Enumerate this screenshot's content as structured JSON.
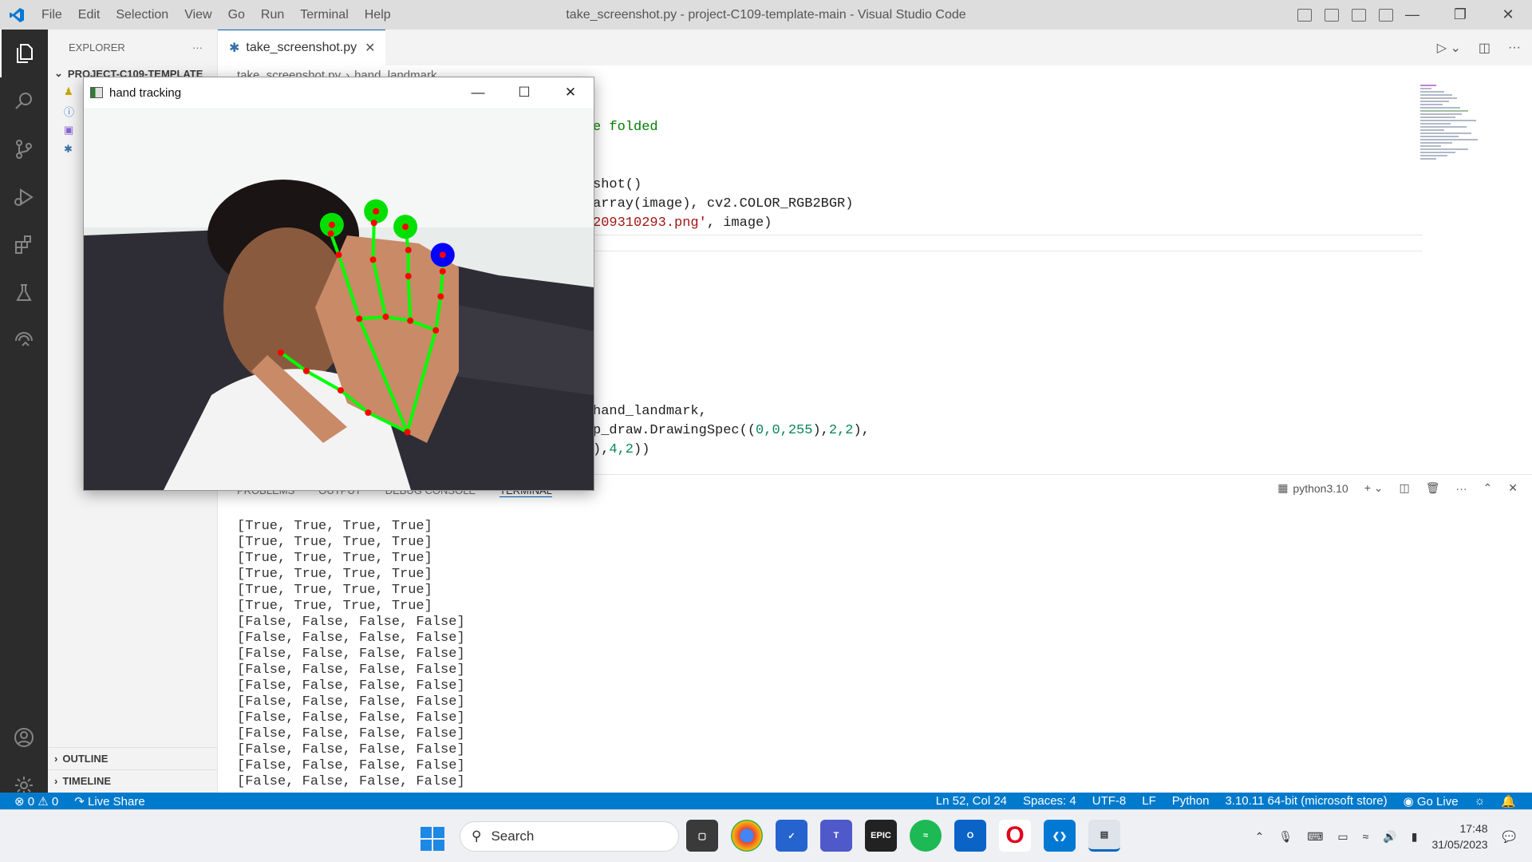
{
  "window": {
    "title": "take_screenshot.py - project-C109-template-main - Visual Studio Code",
    "menu": [
      "File",
      "Edit",
      "Selection",
      "View",
      "Go",
      "Run",
      "Terminal",
      "Help"
    ]
  },
  "sidebar": {
    "header": "EXPLORER",
    "project": "PROJECT-C109-TEMPLATE",
    "outline": "OUTLINE",
    "timeline": "TIMELINE"
  },
  "tab": {
    "filename": "take_screenshot.py"
  },
  "breadcrumb": {
    "file": "take_screenshot.py",
    "symbol": "hand_landmark"
  },
  "code": {
    "l1_comment": "e folded",
    "l2_text": "shot()",
    "l3_a": "array(image), cv2.COLOR_RGB2BGR)",
    "l4_str": "209310293.png'",
    "l4_rest": ", image)",
    "l5_text": "hand_landmark,",
    "l6_a": "p_draw.DrawingSpec((",
    "l6_nums": "0,0,255",
    "l6_b": "),",
    "l6_c": "2,2",
    "l6_d": "),",
    "l7_a": "),",
    "l7_nums": "4,2",
    "l7_b": "))"
  },
  "panel": {
    "tabs": [
      "PROBLEMS",
      "OUTPUT",
      "DEBUG CONSOLE",
      "TERMINAL"
    ],
    "active_tab": "TERMINAL",
    "shell": "python3.10",
    "terminal_lines": [
      "[True, True, True, True]",
      "[True, True, True, True]",
      "[True, True, True, True]",
      "[True, True, True, True]",
      "[True, True, True, True]",
      "[True, True, True, True]",
      "[False, False, False, False]",
      "[False, False, False, False]",
      "[False, False, False, False]",
      "[False, False, False, False]",
      "[False, False, False, False]",
      "[False, False, False, False]",
      "[False, False, False, False]",
      "[False, False, False, False]",
      "[False, False, False, False]",
      "[False, False, False, False]",
      "[False, False, False, False]"
    ]
  },
  "statusbar": {
    "errors": "0",
    "warnings": "0",
    "live_share": "Live Share",
    "position": "Ln 52, Col 24",
    "spaces": "Spaces: 4",
    "encoding": "UTF-8",
    "eol": "LF",
    "language": "Python",
    "interpreter": "3.10.11 64-bit (microsoft store)",
    "go_live": "Go Live"
  },
  "taskbar": {
    "search_placeholder": "Search",
    "time": "17:48",
    "date": "31/05/2023",
    "apps": [
      "file-explorer",
      "chrome",
      "todo",
      "teams",
      "epic-games",
      "spotify",
      "outlook",
      "opera",
      "vscode",
      "python"
    ]
  },
  "hand_window": {
    "title": "hand tracking",
    "fingers": [
      {
        "name": "index",
        "state": "raised"
      },
      {
        "name": "middle",
        "state": "raised"
      },
      {
        "name": "ring",
        "state": "raised"
      },
      {
        "name": "pinky",
        "state": "raised"
      }
    ],
    "colors": {
      "connection": "#00ff00",
      "landmark": "#ff0000",
      "tip_marker": "#00e000",
      "pinky_tip_marker": "#0000ff"
    }
  },
  "colors": {
    "accent": "#007acc",
    "activity_bar": "#2c2c2c"
  }
}
